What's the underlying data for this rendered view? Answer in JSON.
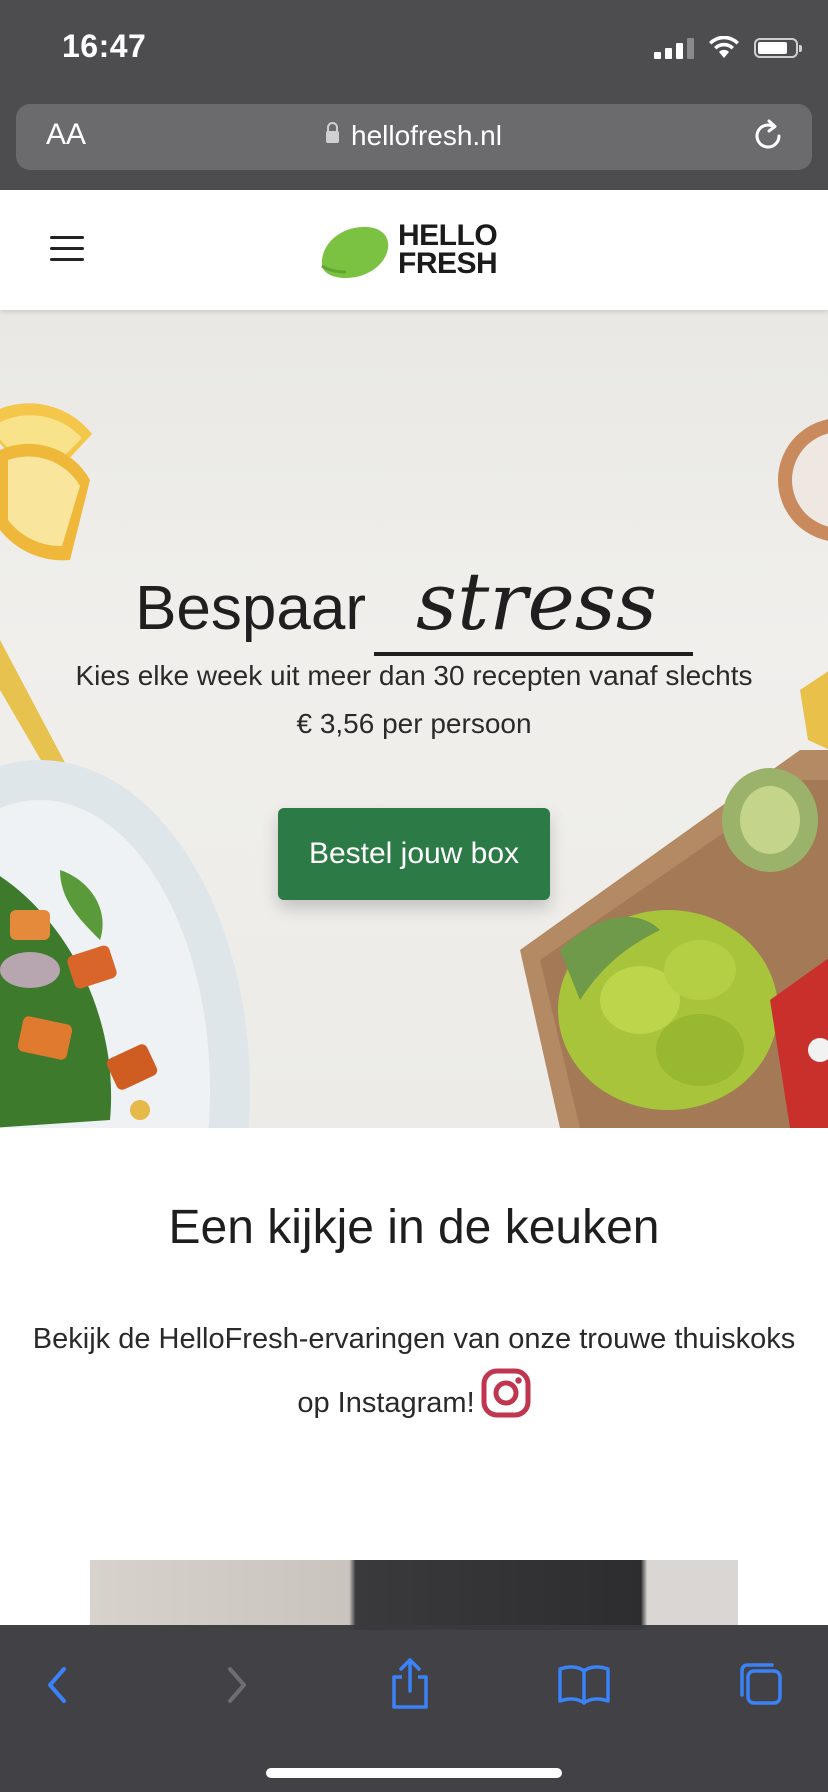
{
  "status_bar": {
    "time": "16:47"
  },
  "browser": {
    "text_size_label": "AA",
    "url": "hellofresh.nl"
  },
  "site": {
    "brand_line1": "HELLO",
    "brand_line2": "FRESH"
  },
  "hero": {
    "title_prefix": "Bespaar",
    "title_highlight": "stress",
    "subtitle_line1": "Kies elke week uit meer dan 30 recepten vanaf slechts",
    "subtitle_line2": "€ 3,56 per persoon",
    "cta_label": "Bestel jouw box"
  },
  "kitchen": {
    "title": "Een kijkje in de keuken",
    "text_line1": "Bekijk de HelloFresh-ervaringen van onze trouwe thuiskoks",
    "text_line2": "op Instagram!"
  },
  "icons": {
    "menu": "menu-icon",
    "reload": "reload-icon",
    "lock": "lock-icon",
    "instagram": "instagram-icon",
    "back": "chevron-left-icon",
    "forward": "chevron-right-icon",
    "share": "share-icon",
    "bookmarks": "book-icon",
    "tabs": "tabs-icon"
  },
  "colors": {
    "brand_green": "#2c7a46",
    "lime": "#7cc242",
    "instagram": "#c0364f",
    "ios_blue": "#3a82f7"
  }
}
